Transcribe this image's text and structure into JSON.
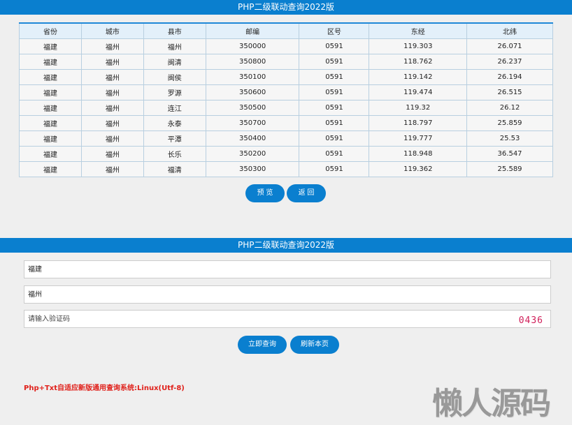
{
  "title": "PHP二级联动查询2022版",
  "table": {
    "headers": [
      "省份",
      "城市",
      "县市",
      "邮编",
      "区号",
      "东经",
      "北纬"
    ],
    "rows": [
      [
        "福建",
        "福州",
        "福州",
        "350000",
        "0591",
        "119.303",
        "26.071"
      ],
      [
        "福建",
        "福州",
        "闽清",
        "350800",
        "0591",
        "118.762",
        "26.237"
      ],
      [
        "福建",
        "福州",
        "闽侯",
        "350100",
        "0591",
        "119.142",
        "26.194"
      ],
      [
        "福建",
        "福州",
        "罗源",
        "350600",
        "0591",
        "119.474",
        "26.515"
      ],
      [
        "福建",
        "福州",
        "连江",
        "350500",
        "0591",
        "119.32",
        "26.12"
      ],
      [
        "福建",
        "福州",
        "永泰",
        "350700",
        "0591",
        "118.797",
        "25.859"
      ],
      [
        "福建",
        "福州",
        "平潭",
        "350400",
        "0591",
        "119.777",
        "25.53"
      ],
      [
        "福建",
        "福州",
        "长乐",
        "350200",
        "0591",
        "118.948",
        "36.547"
      ],
      [
        "福建",
        "福州",
        "福清",
        "350300",
        "0591",
        "119.362",
        "25.589"
      ]
    ]
  },
  "buttons": {
    "preview": "预 览",
    "back": "返 回",
    "query": "立即查询",
    "refresh": "刷新本页"
  },
  "form": {
    "province": "福建",
    "city": "福州",
    "captcha_placeholder": "请输入验证码",
    "captcha_code": "0436"
  },
  "footer": "Php+Txt自适应新版通用查询系统:Linux(Utf-8)",
  "watermark": "懒人源码"
}
